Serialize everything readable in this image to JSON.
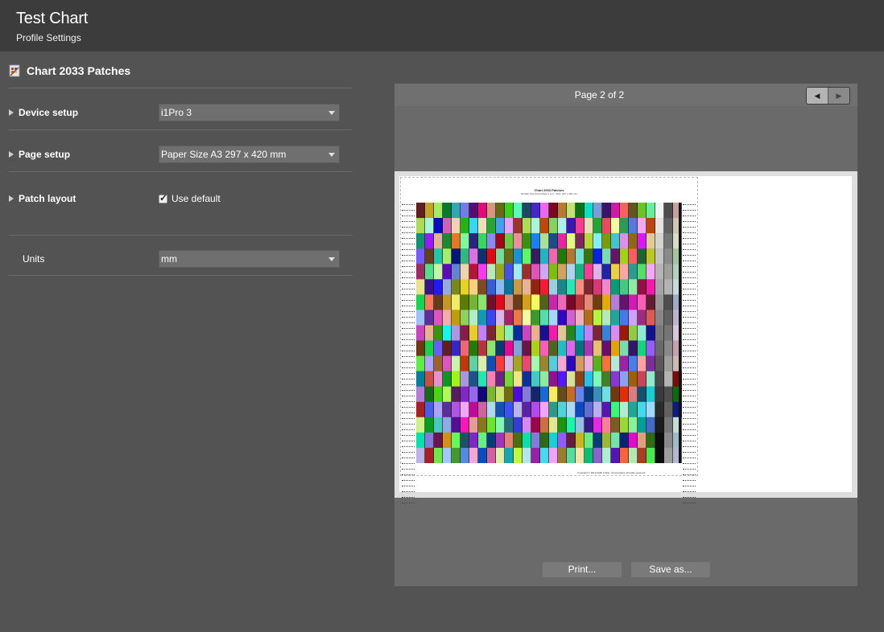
{
  "header": {
    "title": "Test Chart",
    "subtitle": "Profile Settings"
  },
  "chart": {
    "icon": "chart-document-icon",
    "title": "Chart 2033 Patches"
  },
  "settings": {
    "device_setup": {
      "label": "Device setup",
      "value": "i1Pro 3"
    },
    "page_setup": {
      "label": "Page setup",
      "value": "Paper Size A3  297 x 420 mm"
    },
    "patch_layout": {
      "label": "Patch layout",
      "checkbox_label": "Use default",
      "checked": true
    },
    "units": {
      "label": "Units",
      "value": "mm"
    }
  },
  "preview": {
    "page_indicator": "Page 2 of 2",
    "prev_icon": "left-arrow-icon",
    "next_icon": "right-arrow-icon",
    "page_title": "Chart 2033 Patches",
    "page_subtitle": "iProfiler Test Chart Page 2 of 2 · Size: 297 x 420 mm",
    "page_footer": "Copyright © 2013-2020 X-Rite, Incorporated. All rights reserved."
  },
  "actions": {
    "print_label": "Print...",
    "save_label": "Save as..."
  },
  "colors": {
    "background": "#535353",
    "header": "#3c3c3c",
    "panel": "#6a6a6a",
    "button": "#7a7a7a"
  }
}
